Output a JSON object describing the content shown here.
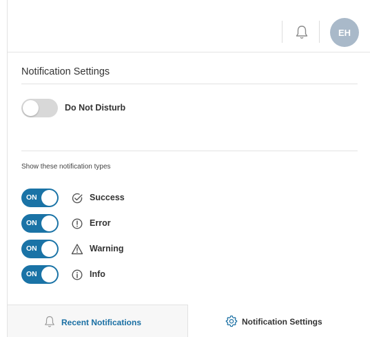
{
  "header": {
    "avatar_initials": "EH",
    "bell_icon": "bell-icon"
  },
  "settings": {
    "title": "Notification Settings",
    "do_not_disturb": {
      "label": "Do Not Disturb",
      "enabled": false
    },
    "types_label": "Show these notification types",
    "types": [
      {
        "label": "Success",
        "toggle_text": "ON",
        "icon": "check-circle-icon",
        "enabled": true
      },
      {
        "label": "Error",
        "toggle_text": "ON",
        "icon": "exclamation-circle-icon",
        "enabled": true
      },
      {
        "label": "Warning",
        "toggle_text": "ON",
        "icon": "warning-triangle-icon",
        "enabled": true
      },
      {
        "label": "Info",
        "toggle_text": "ON",
        "icon": "info-circle-icon",
        "enabled": true
      }
    ]
  },
  "tabs": [
    {
      "label": "Recent Notifications",
      "icon": "bell-icon",
      "active": false
    },
    {
      "label": "Notification Settings",
      "icon": "gear-icon",
      "active": true
    }
  ],
  "colors": {
    "toggle_on": "#1a73a6",
    "toggle_off": "#d8d8d8",
    "avatar": "#a9b9c9",
    "link": "#1a6fa3"
  }
}
